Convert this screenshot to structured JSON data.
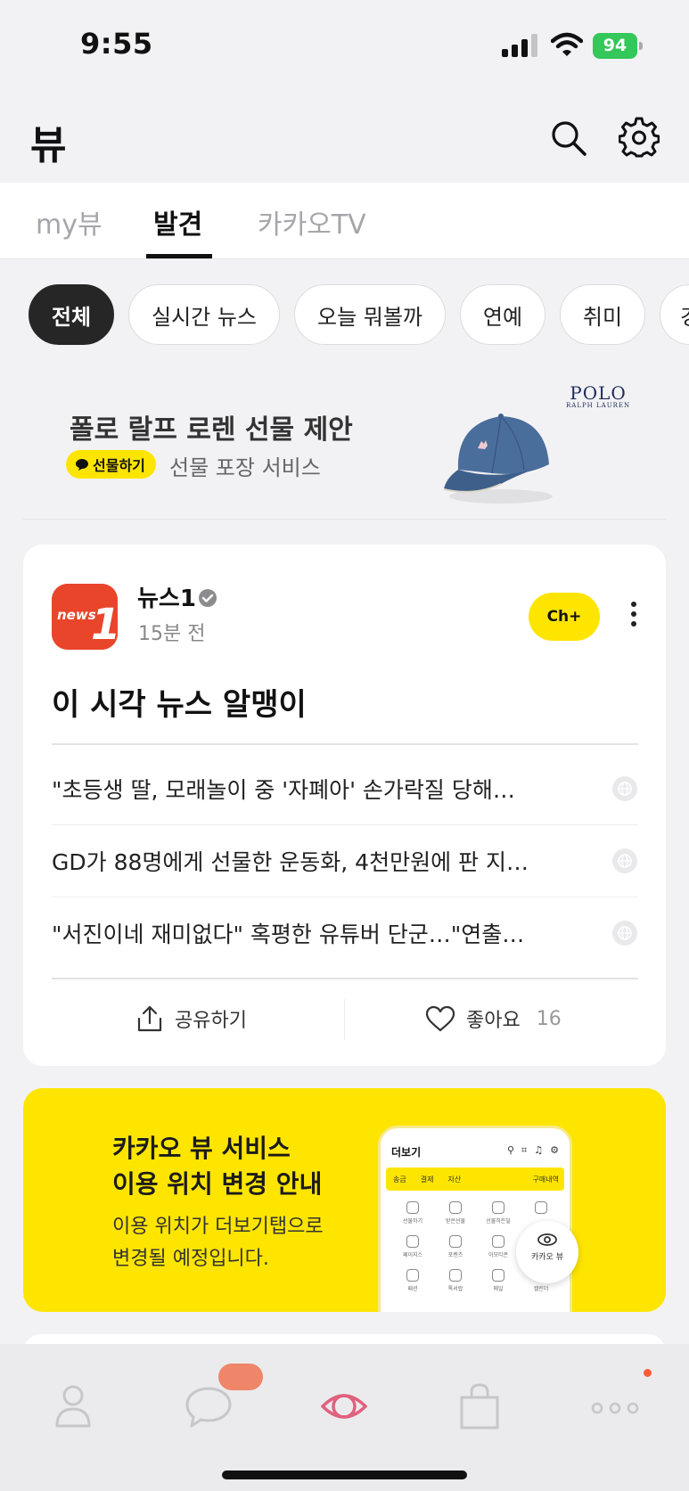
{
  "status_bar": {
    "time": "9:55",
    "battery": "94"
  },
  "header": {
    "title": "뷰"
  },
  "tabs": [
    {
      "label": "my뷰",
      "active": false
    },
    {
      "label": "발견",
      "active": true
    },
    {
      "label": "카카오TV",
      "active": false
    }
  ],
  "chips": [
    "전체",
    "실시간 뉴스",
    "오늘 뭐볼까",
    "연예",
    "취미",
    "경"
  ],
  "banner": {
    "title": "폴로 랄프 로렌 선물 제안",
    "badge": "선물하기",
    "subtitle": "선물 포장 서비스",
    "brand": "POLO",
    "brand_sub": "RALPH LAUREN"
  },
  "news_card": {
    "publisher": "뉴스1",
    "time_ago": "15분 전",
    "channel_button": "Ch+",
    "headline": "이 시각 뉴스 알맹이",
    "items": [
      "\"초등생 딸, 모래놀이 중 '자폐아' 손가락질 당해…",
      "GD가 88명에게 선물한 운동화, 4천만원에 판 지…",
      "\"서진이네 재미없다\" 혹평한 유튜버 단군…\"연출…"
    ],
    "share_label": "공유하기",
    "like_label": "좋아요",
    "like_count": "16"
  },
  "promo": {
    "title_line1": "카카오 뷰 서비스",
    "title_line2": "이용 위치 변경 안내",
    "desc_line1": "이용 위치가 더보기탭으로",
    "desc_line2": "변경될 예정입니다.",
    "phone_title": "더보기",
    "phone_tabs": [
      "송금",
      "결제",
      "자산"
    ],
    "phone_order": "구매내역",
    "phone_items": [
      "선물하기",
      "받은선물",
      "선물히든딜",
      "",
      "페이지스",
      "포렌즈",
      "이모티콘",
      "",
      "패션",
      "톡서랍",
      "메일",
      "캘린더"
    ],
    "fab_label": "카카오 뷰"
  },
  "colors": {
    "kakao_yellow": "#fee500",
    "news1_red": "#e8452a",
    "nav_active": "#e0617e"
  }
}
